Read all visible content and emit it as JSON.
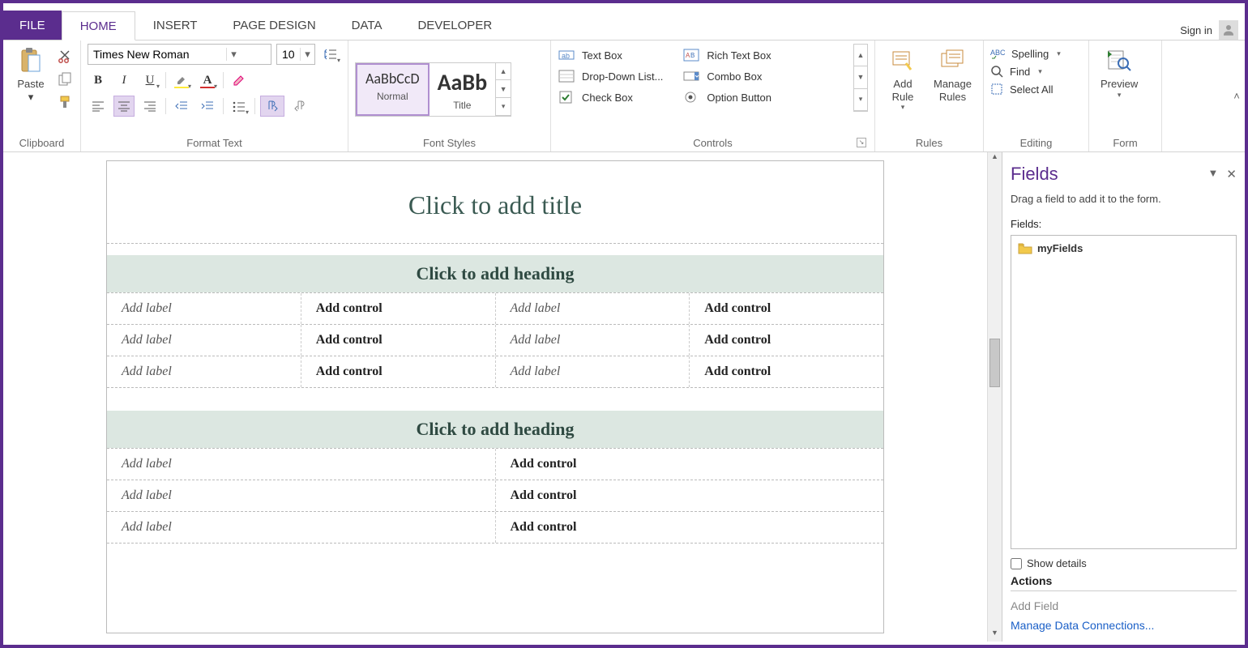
{
  "tabs": {
    "file": "FILE",
    "items": [
      "HOME",
      "INSERT",
      "PAGE DESIGN",
      "DATA",
      "DEVELOPER"
    ],
    "active": 0,
    "signin": "Sign in"
  },
  "ribbon": {
    "clipboard": {
      "label": "Clipboard",
      "paste": "Paste"
    },
    "format_text": {
      "label": "Format Text",
      "font_name": "Times New Roman",
      "font_size": "10"
    },
    "font_styles": {
      "label": "Font Styles",
      "items": [
        {
          "preview": "AaBbCcD",
          "name": "Normal"
        },
        {
          "preview": "AaBb",
          "name": "Title"
        }
      ]
    },
    "controls": {
      "label": "Controls",
      "col1": [
        "Text Box",
        "Drop-Down List...",
        "Check Box"
      ],
      "col2": [
        "Rich Text Box",
        "Combo Box",
        "Option Button"
      ]
    },
    "rules": {
      "label": "Rules",
      "add": "Add\nRule",
      "manage": "Manage\nRules"
    },
    "editing": {
      "label": "Editing",
      "spelling": "Spelling",
      "find": "Find",
      "select_all": "Select All"
    },
    "form": {
      "label": "Form",
      "preview": "Preview"
    }
  },
  "canvas": {
    "title_placeholder": "Click to add title",
    "heading_placeholder": "Click to add heading",
    "label_placeholder": "Add label",
    "control_placeholder": "Add control"
  },
  "task_pane": {
    "title": "Fields",
    "hint": "Drag a field to add it to the form.",
    "fields_label": "Fields:",
    "root": "myFields",
    "show_details": "Show details",
    "actions_label": "Actions",
    "add_field": "Add Field",
    "manage_conn": "Manage Data Connections..."
  }
}
